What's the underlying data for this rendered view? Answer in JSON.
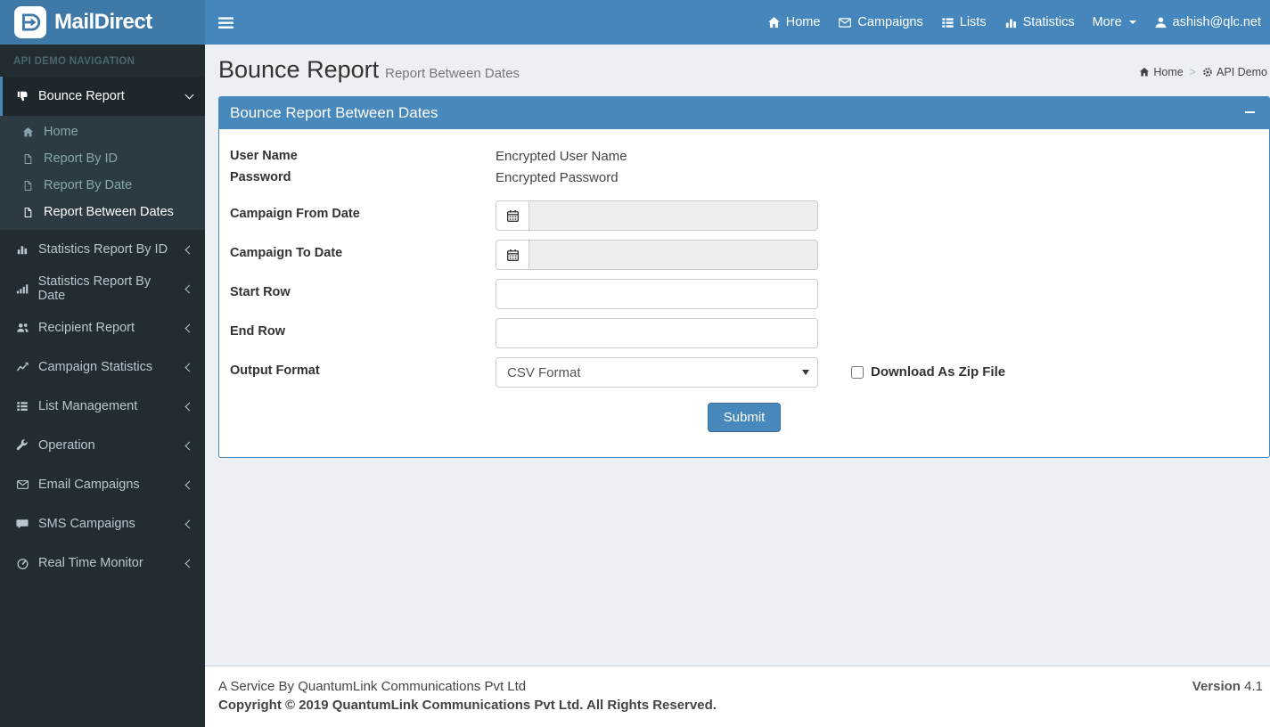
{
  "colors": {
    "navbar": "#4587bd",
    "logo_bg": "#3e79a8",
    "sidebar_bg": "#222d32",
    "sidebar_active_bg": "#1e282c",
    "submenu_bg": "#2c3b41",
    "accent": "#4788bd",
    "content_bg": "#ecf0f5",
    "disabled_input_bg": "#eeeeee"
  },
  "brand": {
    "name": "MailDirect"
  },
  "navbar": {
    "home": "Home",
    "campaigns": "Campaigns",
    "lists": "Lists",
    "statistics": "Statistics",
    "more": "More",
    "user_email": "ashish@qlc.net"
  },
  "sidebar": {
    "section_label": "API DEMO NAVIGATION",
    "tree": {
      "label": "Bounce Report",
      "children": [
        {
          "label": "Home"
        },
        {
          "label": "Report By ID"
        },
        {
          "label": "Report By Date"
        },
        {
          "label": "Report Between Dates"
        }
      ]
    },
    "items": [
      {
        "label": "Statistics Report By ID"
      },
      {
        "label": "Statistics Report By Date"
      },
      {
        "label": "Recipient Report"
      },
      {
        "label": "Campaign Statistics"
      },
      {
        "label": "List Management"
      },
      {
        "label": "Operation"
      },
      {
        "label": "Email Campaigns"
      },
      {
        "label": "SMS Campaigns"
      },
      {
        "label": "Real Time Monitor"
      }
    ]
  },
  "page": {
    "title": "Bounce Report",
    "subtitle": "Report Between Dates"
  },
  "breadcrumb": {
    "home": "Home",
    "separator": ">",
    "current": "API Demo"
  },
  "panel": {
    "title": "Bounce Report Between Dates"
  },
  "form": {
    "user_name_label": "User Name",
    "user_name_value": "Encrypted User Name",
    "password_label": "Password",
    "password_value": "Encrypted Password",
    "campaign_from_label": "Campaign From Date",
    "campaign_from_value": "",
    "campaign_to_label": "Campaign To Date",
    "campaign_to_value": "",
    "start_row_label": "Start Row",
    "start_row_value": "",
    "end_row_label": "End Row",
    "end_row_value": "",
    "output_format_label": "Output Format",
    "output_format_value": "CSV Format",
    "zip_label": "Download As Zip File",
    "zip_checked": false,
    "submit_label": "Submit"
  },
  "footer": {
    "line1": "A Service By QuantumLink Communications Pvt Ltd",
    "line2": "Copyright © 2019 QuantumLink Communications Pvt Ltd. All Rights Reserved.",
    "version_label": "Version",
    "version_value": "4.1"
  }
}
